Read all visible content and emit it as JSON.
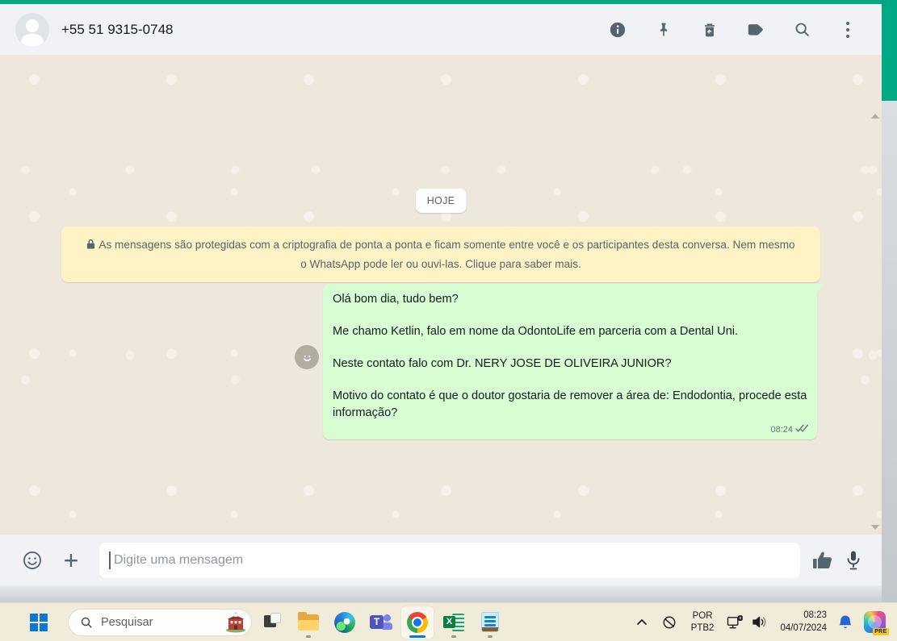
{
  "header": {
    "phone": "+55 51 9315-0748"
  },
  "chat": {
    "date_divider": "HOJE",
    "encryption_notice": "As mensagens são protegidas com a criptografia de ponta a ponta e ficam somente entre você e os participantes desta conversa. Nem mesmo o WhatsApp pode ler ou ouvi-las. Clique para saber mais.",
    "message": {
      "paragraphs": [
        "Olá bom dia, tudo bem?",
        "Me chamo Ketlin, falo em nome da OdontoLife em parceria com a Dental Uni.",
        "Neste contato falo com Dr. NERY JOSE DE OLIVEIRA JUNIOR?",
        "Motivo do contato é que o doutor gostaria de remover a área de:  Endodontia, procede esta informação?"
      ],
      "time": "08:24",
      "status": "delivered"
    }
  },
  "composer": {
    "placeholder": "Digite uma mensagem"
  },
  "taskbar": {
    "search_placeholder": "Pesquisar",
    "tray": {
      "language_line1": "POR",
      "language_line2": "PTB2",
      "time": "08:23",
      "date": "04/07/2024",
      "copilot_badge": "PRE"
    }
  },
  "icons": {
    "plus_glyph": "+",
    "teams_letter": "T",
    "excel_letter": "X"
  },
  "colors": {
    "whatsapp_teal": "#00a884",
    "bubble_green": "#d9fdd3",
    "banner_yellow": "#fdf3c5",
    "header_gray": "#f0f2f5",
    "icon_slate": "#54656f",
    "chat_beige": "#eee7db",
    "taskbar_beige": "#f1ebd9",
    "active_indicator_blue": "#0b78d0"
  }
}
